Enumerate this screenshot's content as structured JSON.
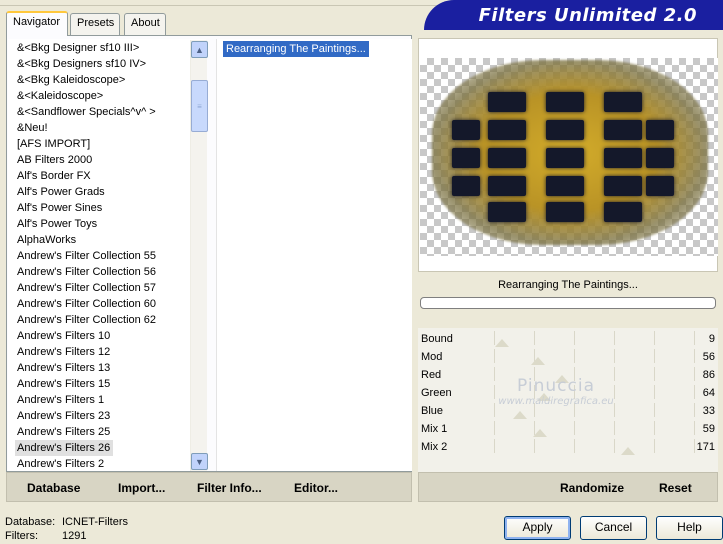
{
  "tabs": [
    "Navigator",
    "Presets",
    "About"
  ],
  "banner_title": "Filters Unlimited 2.0",
  "categories": [
    "&<Bkg Designer sf10 III>",
    "&<Bkg Designers sf10 IV>",
    "&<Bkg Kaleidoscope>",
    "&<Kaleidoscope>",
    "&<Sandflower Specials^v^ >",
    "&Neu!",
    "[AFS IMPORT]",
    "AB Filters 2000",
    "Alf's Border FX",
    "Alf's Power Grads",
    "Alf's Power Sines",
    "Alf's Power Toys",
    "AlphaWorks",
    "Andrew's Filter Collection 55",
    "Andrew's Filter Collection 56",
    "Andrew's Filter Collection 57",
    "Andrew's Filter Collection 60",
    "Andrew's Filter Collection 62",
    "Andrew's Filters 10",
    "Andrew's Filters 12",
    "Andrew's Filters 13",
    "Andrew's Filters 15",
    "Andrew's Filters 1",
    "Andrew's Filters 23",
    "Andrew's Filters 25",
    "Andrew's Filters 26",
    "Andrew's Filters 2"
  ],
  "selected_category": "Andrew's Filters 26",
  "filters": [
    "Rearranging The Paintings..."
  ],
  "selected_filter": "Rearranging The Paintings...",
  "preview_caption": "Rearranging The Paintings...",
  "progress_percent": 0,
  "parameters": [
    {
      "name": "Bound",
      "value": "9",
      "level": 0.04
    },
    {
      "name": "Mod",
      "value": "56",
      "level": 0.22
    },
    {
      "name": "Red",
      "value": "86",
      "level": 0.34
    },
    {
      "name": "Green",
      "value": "64",
      "level": 0.25
    },
    {
      "name": "Blue",
      "value": "33",
      "level": 0.13
    },
    {
      "name": "Mix 1",
      "value": "59",
      "level": 0.23
    },
    {
      "name": "Mix 2",
      "value": "171",
      "level": 0.67
    }
  ],
  "watermark": {
    "title": "Pinuccia",
    "url": "www.maidiregrafica.eu"
  },
  "left_buttons": [
    "Database",
    "Import...",
    "Filter Info...",
    "Editor..."
  ],
  "right_buttons": [
    "Randomize",
    "Reset"
  ],
  "footer": {
    "database_label": "Database:",
    "database_value": "ICNET-Filters",
    "filters_label": "Filters:",
    "filters_value": "1291"
  },
  "dialog_buttons": {
    "apply": "Apply",
    "cancel": "Cancel",
    "help": "Help"
  },
  "colors": {
    "banner": "#1a1fa0",
    "selection": "#316ac5",
    "window": "#ece9d8"
  }
}
